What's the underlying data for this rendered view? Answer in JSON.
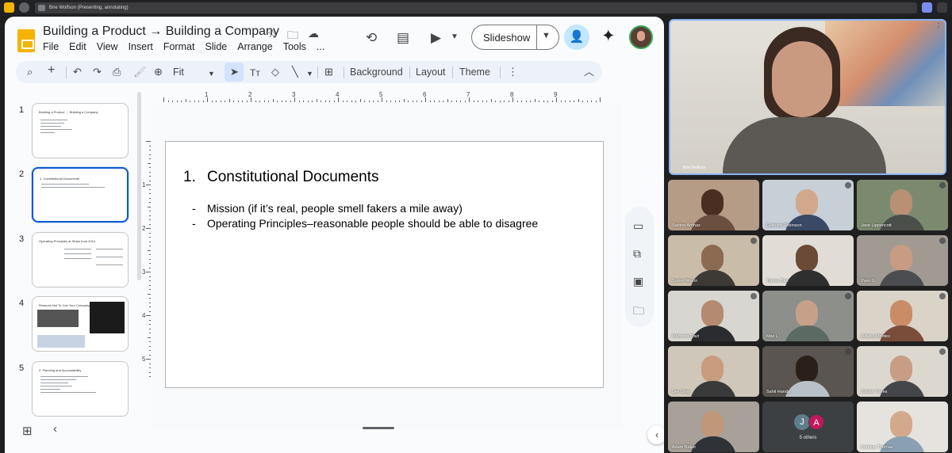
{
  "meet": {
    "presenting_label": "Brie Wolfson (Presenting, annotating)"
  },
  "doc": {
    "title": "Building a Product → Building a Company",
    "menu": [
      "File",
      "Edit",
      "View",
      "Insert",
      "Format",
      "Slide",
      "Arrange",
      "Tools",
      "..."
    ],
    "slideshow_label": "Slideshow"
  },
  "toolbar": {
    "zoom": "Fit",
    "background_label": "Background",
    "layout_label": "Layout",
    "theme_label": "Theme"
  },
  "filmstrip": [
    {
      "num": "1",
      "title": "Building a Product → Building a Company"
    },
    {
      "num": "2",
      "title": "1.   Constitutional Documents"
    },
    {
      "num": "3",
      "title": "Operating Principles at Stripe from 2014"
    },
    {
      "num": "4",
      "title": "Reasons Not To Join Your Company"
    },
    {
      "num": "5",
      "title": "2.  Planning and Accountability"
    }
  ],
  "ruler": {
    "h": [
      "1",
      "2",
      "3",
      "4",
      "5",
      "6",
      "7",
      "8",
      "9"
    ],
    "v": [
      "1",
      "2",
      "3",
      "4",
      "5"
    ]
  },
  "slide": {
    "heading_num": "1.",
    "heading": "Constitutional Documents",
    "bullets": [
      "Mission (if it’s real, people smell fakers a mile away)",
      "Operating Principles–reasonable people should be able to disagree"
    ]
  },
  "participants": [
    {
      "name": "Sabina Arnhaz"
    },
    {
      "name": "Graham Robinson"
    },
    {
      "name": "Jane Lippencott"
    },
    {
      "name": "Soren Wrenn"
    },
    {
      "name": "Tomas Barr"
    },
    {
      "name": "Yves G"
    },
    {
      "name": "Mahmed Qazi"
    },
    {
      "name": "Max L"
    },
    {
      "name": "Juliana Montes"
    },
    {
      "name": "Lee Gray"
    },
    {
      "name": "Sahil Handa"
    },
    {
      "name": "Jordan Torres"
    },
    {
      "name": "Adam Baker"
    },
    {
      "name": "5 others"
    },
    {
      "name": "Corinne Thomas"
    }
  ],
  "others": {
    "initials": [
      "J",
      "A"
    ],
    "label": "5 others"
  },
  "colors": {
    "accent": "#0b57d0",
    "slides_yellow": "#f4b400",
    "meet_dark": "#202124"
  }
}
